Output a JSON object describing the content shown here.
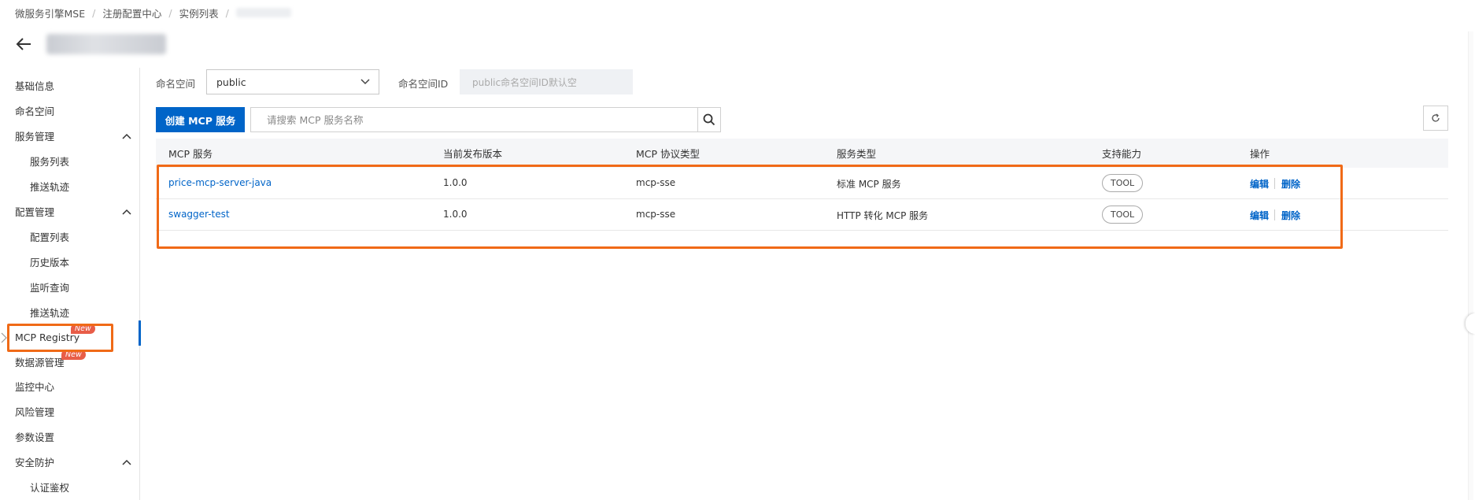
{
  "breadcrumb": {
    "items": [
      "微服务引擎MSE",
      "注册配置中心",
      "实例列表"
    ]
  },
  "sidebar": {
    "items": [
      {
        "label": "基础信息"
      },
      {
        "label": "命名空间"
      },
      {
        "label": "服务管理"
      },
      {
        "label": "服务列表"
      },
      {
        "label": "推送轨迹"
      },
      {
        "label": "配置管理"
      },
      {
        "label": "配置列表"
      },
      {
        "label": "历史版本"
      },
      {
        "label": "监听查询"
      },
      {
        "label": "推送轨迹"
      },
      {
        "label": "MCP Registry",
        "badge": "New"
      },
      {
        "label": "数据源管理",
        "badge": "New"
      },
      {
        "label": "监控中心"
      },
      {
        "label": "风险管理"
      },
      {
        "label": "参数设置"
      },
      {
        "label": "安全防护"
      },
      {
        "label": "认证鉴权"
      }
    ]
  },
  "filters": {
    "namespace_label": "命名空间",
    "namespace_value": "public",
    "namespace_id_label": "命名空间ID",
    "namespace_id_placeholder": "public命名空间ID默认空"
  },
  "toolbar": {
    "create_label": "创建 MCP 服务",
    "search_placeholder": "请搜索 MCP 服务名称"
  },
  "table": {
    "columns": [
      "MCP 服务",
      "当前发布版本",
      "MCP 协议类型",
      "服务类型",
      "支持能力",
      "操作"
    ],
    "rows": [
      {
        "name": "price-mcp-server-java",
        "version": "1.0.0",
        "protocol": "mcp-sse",
        "type": "标准 MCP 服务",
        "capability": "TOOL",
        "edit": "编辑",
        "delete": "删除"
      },
      {
        "name": "swagger-test",
        "version": "1.0.0",
        "protocol": "mcp-sse",
        "type": "HTTP 转化 MCP 服务",
        "capability": "TOOL",
        "edit": "编辑",
        "delete": "删除"
      }
    ]
  },
  "colors": {
    "primary": "#0064c8",
    "highlight": "#f06a17",
    "badge": "#e85d48"
  }
}
